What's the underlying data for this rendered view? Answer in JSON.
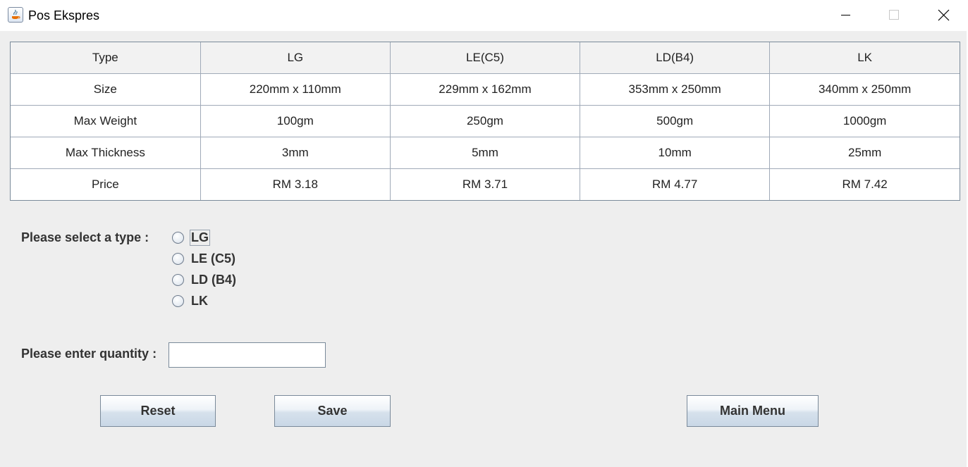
{
  "window": {
    "title": "Pos Ekspres"
  },
  "table": {
    "rows": [
      [
        "Type",
        "LG",
        "LE(C5)",
        "LD(B4)",
        "LK"
      ],
      [
        "Size",
        "220mm x 110mm",
        "229mm x 162mm",
        "353mm x 250mm",
        "340mm x 250mm"
      ],
      [
        "Max Weight",
        "100gm",
        "250gm",
        "500gm",
        "1000gm"
      ],
      [
        "Max Thickness",
        "3mm",
        "5mm",
        "10mm",
        "25mm"
      ],
      [
        "Price",
        "RM 3.18",
        "RM 3.71",
        "RM 4.77",
        "RM 7.42"
      ]
    ]
  },
  "type_select": {
    "label": "Please select a type :",
    "options": [
      "LG",
      "LE (C5)",
      "LD (B4)",
      "LK"
    ]
  },
  "quantity": {
    "label": "Please enter quantity :",
    "value": ""
  },
  "buttons": {
    "reset": "Reset",
    "save": "Save",
    "main_menu": "Main Menu"
  }
}
